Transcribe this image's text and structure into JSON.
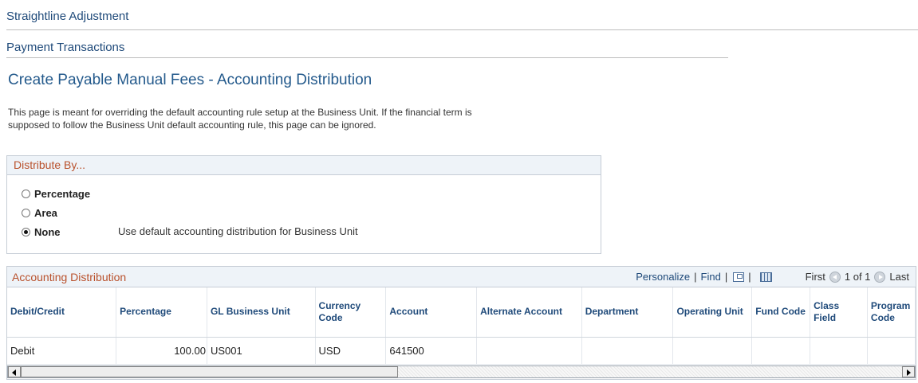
{
  "sections": {
    "straightline": "Straightline Adjustment",
    "payment": "Payment Transactions"
  },
  "page_title": "Create Payable Manual Fees - Accounting Distribution",
  "instructions": "This page is meant for overriding the default accounting rule setup at the Business Unit. If the financial term is supposed to follow the Business Unit default accounting rule, this page can be ignored.",
  "distribute_by": {
    "title": "Distribute By...",
    "options": [
      "Percentage",
      "Area",
      "None"
    ],
    "selected": "None",
    "none_help": "Use default accounting distribution for Business Unit"
  },
  "grid": {
    "title": "Accounting Distribution",
    "personalize": "Personalize",
    "find": "Find",
    "first": "First",
    "range": "1 of 1",
    "last": "Last",
    "columns": [
      "Debit/Credit",
      "Percentage",
      "GL Business Unit",
      "Currency Code",
      "Account",
      "Alternate Account",
      "Department",
      "Operating Unit",
      "Fund Code",
      "Class Field",
      "Program Code"
    ],
    "rows": [
      [
        "Debit",
        "100.00",
        "US001",
        "USD",
        "641500",
        "",
        "",
        "",
        "",
        "",
        ""
      ]
    ]
  },
  "icons": {
    "zoom": "view-all-icon",
    "download": "download-spreadsheet-icon",
    "prev": "previous-icon",
    "next": "next-icon"
  }
}
